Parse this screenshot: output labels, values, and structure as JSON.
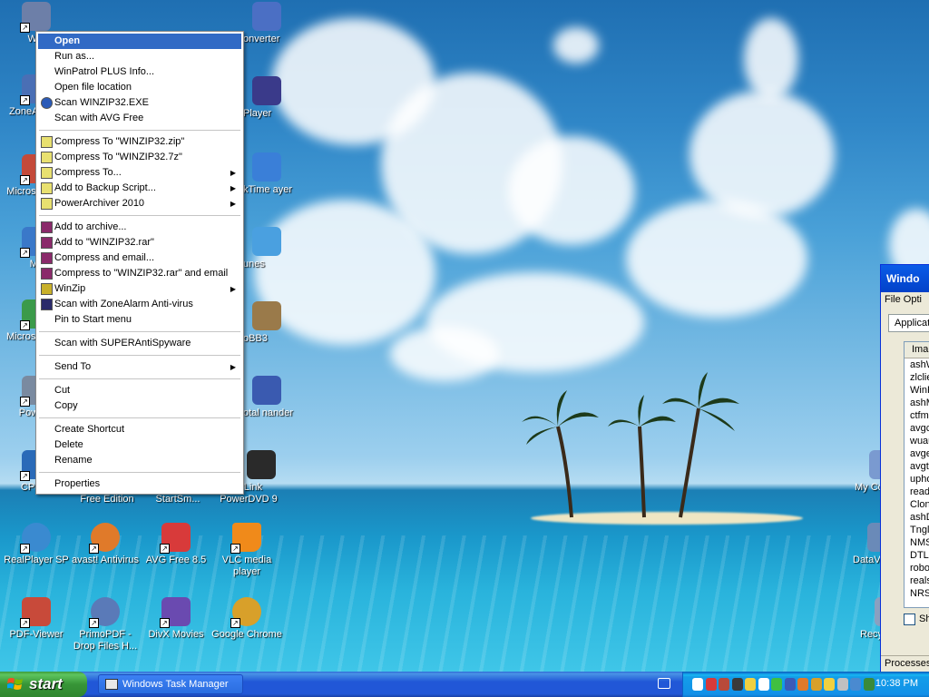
{
  "desktop": {
    "icons": [
      {
        "label": "Win",
        "color": "#6d7fa8"
      },
      {
        "label": "ZoneA Secu",
        "color": "#4a6fb5"
      },
      {
        "label": "Microsof C++",
        "color": "#c44a3a"
      },
      {
        "label": "My",
        "color": "#3a78c9"
      },
      {
        "label": "Microsof Basi",
        "color": "#3b9a4a"
      },
      {
        "label": "PowerA",
        "color": "#7a8aa0"
      },
      {
        "label": "CPUID",
        "color": "#2a6ab8"
      },
      {
        "label": "onverter",
        "color": "#4b6fc4"
      },
      {
        "label": "Player",
        "color": "#3a3a8a"
      },
      {
        "label": "kTime ayer",
        "color": "#3a7fd8"
      },
      {
        "label": "unes",
        "color": "#4aa0e0"
      },
      {
        "label": "oBB3",
        "color": "#9a7a4a"
      },
      {
        "label": "otal nander",
        "color": "#3a5ab0"
      },
      {
        "label": "erLink PowerDVD 9",
        "color": "#2a2a2a"
      },
      {
        "label": "Free Edition",
        "color": "#4a8ac4"
      },
      {
        "label": "StartSm...",
        "color": "#4a7ac8"
      },
      {
        "label": "RealPlayer SP",
        "color": "#3a8ad0"
      },
      {
        "label": "avast! Antivirus",
        "color": "#e07a2a"
      },
      {
        "label": "AVG Free 8.5",
        "color": "#d83a3a"
      },
      {
        "label": "VLC media player",
        "color": "#f08a1a"
      },
      {
        "label": "PDF-Viewer",
        "color": "#c84a3a"
      },
      {
        "label": "PrimoPDF - Drop Files H...",
        "color": "#5a7ab8"
      },
      {
        "label": "DivX Movies",
        "color": "#6a4ab0"
      },
      {
        "label": "Google Chrome",
        "color": "#d8a02a"
      },
      {
        "label": "My Co",
        "color": "#7a9ad0"
      },
      {
        "label": "DataV",
        "color": "#6a8ab8"
      },
      {
        "label": "Recy",
        "color": "#8aa0c0"
      }
    ]
  },
  "context_menu": {
    "items": [
      {
        "label": "Open",
        "bold": true,
        "selected": true
      },
      {
        "label": "Run as..."
      },
      {
        "label": "WinPatrol PLUS Info..."
      },
      {
        "label": "Open file location"
      },
      {
        "label": "Scan WINZIP32.EXE",
        "icon": "avast-icon"
      },
      {
        "label": "Scan with AVG Free"
      },
      {
        "label": "Compress To \"WINZIP32.zip\"",
        "icon": "archive-icon"
      },
      {
        "label": "Compress To \"WINZIP32.7z\"",
        "icon": "archive-icon"
      },
      {
        "label": "Compress To...",
        "icon": "archive-icon",
        "submenu": true
      },
      {
        "label": "Add to Backup Script...",
        "icon": "archive-icon",
        "submenu": true
      },
      {
        "label": "PowerArchiver 2010",
        "icon": "archive-icon",
        "submenu": true
      },
      {
        "label": "Add to archive...",
        "icon": "winrar-icon"
      },
      {
        "label": "Add to \"WINZIP32.rar\"",
        "icon": "winrar-icon"
      },
      {
        "label": "Compress and email...",
        "icon": "winrar-icon"
      },
      {
        "label": "Compress to \"WINZIP32.rar\" and email",
        "icon": "winrar-icon"
      },
      {
        "label": "WinZip",
        "icon": "winzip-icon",
        "submenu": true
      },
      {
        "label": "Scan with ZoneAlarm Anti-virus",
        "icon": "zonealarm-icon"
      },
      {
        "label": "Pin to Start menu"
      },
      {
        "label": "Scan with SUPERAntiSpyware"
      },
      {
        "label": "Send To",
        "submenu": true
      },
      {
        "label": "Cut"
      },
      {
        "label": "Copy"
      },
      {
        "label": "Create Shortcut"
      },
      {
        "label": "Delete"
      },
      {
        "label": "Rename"
      },
      {
        "label": "Properties"
      }
    ],
    "separators_after": [
      5,
      10,
      17,
      18,
      19,
      21,
      24
    ]
  },
  "task_manager": {
    "title": "Windo",
    "menu": "File  Opti",
    "tab": "Applicat",
    "column": "Ima",
    "processes": [
      "ashW",
      "zlclie",
      "WinP",
      "ashM",
      "ctfm",
      "avgc",
      "wuau",
      "avge",
      "avgt",
      "upho",
      "read",
      "Clon",
      "ashD",
      "Tngl",
      "NMS",
      "DTLi",
      "robo",
      "reals",
      "NRS"
    ],
    "checkbox_label": "Sh",
    "status": "Processes"
  },
  "taskbar": {
    "start_label": "start",
    "task_button": "Windows Task Manager",
    "clock": "10:38 PM",
    "tray_icons": [
      {
        "name": "bluetooth-icon",
        "color": "#ffffff"
      },
      {
        "name": "zonealarm-tray-icon",
        "color": "#d83a3a"
      },
      {
        "name": "winpatrol-icon",
        "color": "#b84a3a"
      },
      {
        "name": "avg-tray-icon",
        "color": "#3a3a3a"
      },
      {
        "name": "folder-tray-icon",
        "color": "#f0d040"
      },
      {
        "name": "speaker-tray-icon",
        "color": "#ffffff"
      },
      {
        "name": "network-tray-icon",
        "color": "#40c040"
      },
      {
        "name": "info-tray-icon",
        "color": "#3a5ab8"
      },
      {
        "name": "avast-tray-icon",
        "color": "#e07a2a"
      },
      {
        "name": "chrome-tray-icon",
        "color": "#d8a02a"
      },
      {
        "name": "warning-tray-icon",
        "color": "#f0d040"
      },
      {
        "name": "usb-tray-icon",
        "color": "#c0c0c0"
      },
      {
        "name": "monitor-tray-icon",
        "color": "#4a8ad0"
      },
      {
        "name": "shield-tray-icon",
        "color": "#3a8a3a"
      }
    ]
  }
}
